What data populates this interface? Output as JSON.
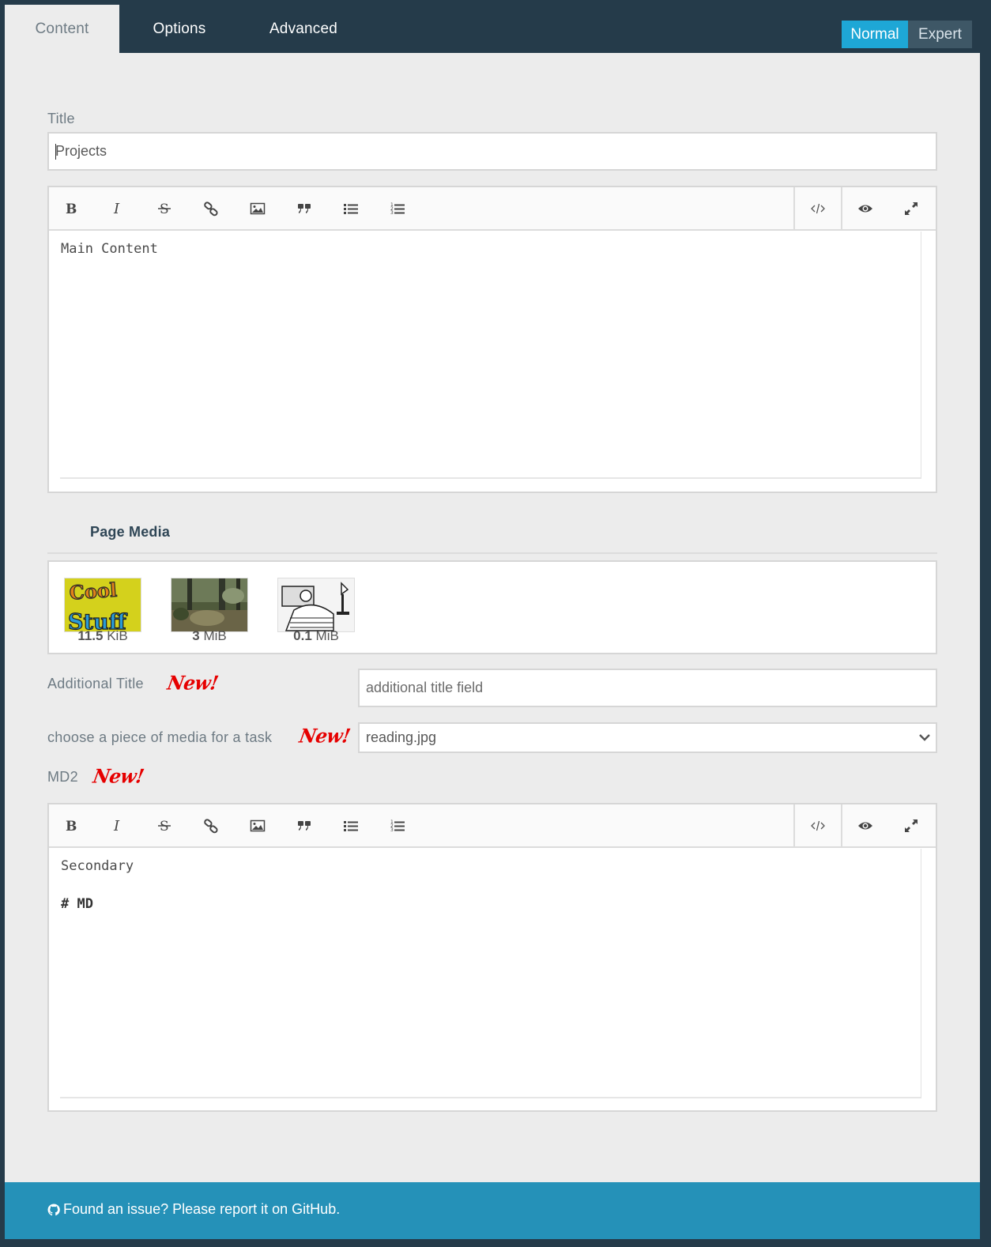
{
  "tabs": [
    "Content",
    "Options",
    "Advanced"
  ],
  "modes": [
    "Normal",
    "Expert"
  ],
  "title_field": {
    "label": "Title",
    "value": "Projects"
  },
  "editor1": {
    "lines": [
      "Main Content"
    ]
  },
  "toolbar_icons": [
    "bold-icon",
    "italic-icon",
    "strikethrough-icon",
    "link-icon",
    "image-icon",
    "quote-icon",
    "bullet-list-icon",
    "numbered-list-icon",
    "code-icon",
    "preview-icon",
    "fullscreen-icon"
  ],
  "media": {
    "heading": "Page Media",
    "items": [
      {
        "size_num": "11.5",
        "size_unit": "KiB",
        "picture": "cool-stuff"
      },
      {
        "size_num": "3",
        "size_unit": "MiB",
        "picture": "forest"
      },
      {
        "size_num": "0.1",
        "size_unit": "MiB",
        "picture": "reading"
      }
    ]
  },
  "additional_title": {
    "label": "Additional Title",
    "badge": "New!",
    "placeholder": "additional title field"
  },
  "media_select": {
    "label": "choose a piece of media for a task",
    "badge": "New!",
    "value": "reading.jpg"
  },
  "md2": {
    "label": "MD2",
    "badge": "New!",
    "line1": "Secondary",
    "line2": "# MD"
  },
  "footer": {
    "text": "Found an issue? Please report it on GitHub."
  },
  "colors": {
    "accent": "#1ea7d6",
    "topbar": "#253b4a",
    "footer": "#2591b8",
    "badge": "#e60000"
  }
}
